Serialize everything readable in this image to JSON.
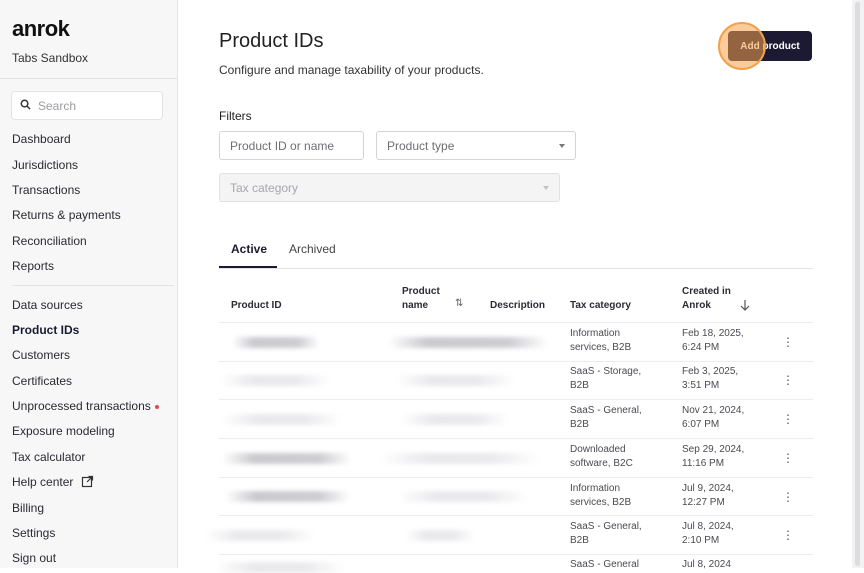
{
  "sidebar": {
    "logo": "anrok",
    "org_name": "Tabs Sandbox",
    "search_placeholder": "Search",
    "nav_group_1": [
      {
        "label": "Dashboard"
      },
      {
        "label": "Jurisdictions"
      },
      {
        "label": "Transactions"
      },
      {
        "label": "Returns & payments"
      },
      {
        "label": "Reconciliation"
      },
      {
        "label": "Reports"
      }
    ],
    "nav_group_2": [
      {
        "label": "Data sources"
      },
      {
        "label": "Product IDs"
      },
      {
        "label": "Customers"
      },
      {
        "label": "Certificates"
      },
      {
        "label": "Unprocessed transactions"
      },
      {
        "label": "Exposure modeling"
      },
      {
        "label": "Tax calculator"
      },
      {
        "label": "Help center"
      },
      {
        "label": "Billing"
      },
      {
        "label": "Settings"
      },
      {
        "label": "Sign out"
      }
    ],
    "active_item": "Product IDs"
  },
  "header": {
    "title": "Product IDs",
    "subtitle": "Configure and manage taxability of your products.",
    "add_button": "Add product"
  },
  "filters": {
    "label": "Filters",
    "product_id_placeholder": "Product ID or name",
    "product_type": "Product type",
    "tax_category": "Tax category"
  },
  "tabs": [
    {
      "label": "Active",
      "active": true
    },
    {
      "label": "Archived",
      "active": false
    }
  ],
  "table": {
    "headers": {
      "product_id": "Product ID",
      "product_name_1": "Product",
      "product_name_2": "name",
      "description": "Description",
      "tax_category": "Tax category",
      "created_1": "Created in",
      "created_2": "Anrok"
    },
    "rows": [
      {
        "tax_1": "Information",
        "tax_2": "services, B2B",
        "date_1": "Feb 18, 2025,",
        "date_2": "6:24 PM"
      },
      {
        "tax_1": "SaaS - Storage,",
        "tax_2": "B2B",
        "date_1": "Feb 3, 2025,",
        "date_2": "3:51 PM"
      },
      {
        "tax_1": "SaaS - General,",
        "tax_2": "B2B",
        "date_1": "Nov 21, 2024,",
        "date_2": "6:07 PM"
      },
      {
        "tax_1": "Downloaded",
        "tax_2": "software, B2C",
        "date_1": "Sep 29, 2024,",
        "date_2": "11:16 PM"
      },
      {
        "tax_1": "Information",
        "tax_2": "services, B2B",
        "date_1": "Jul 9, 2024,",
        "date_2": "12:27 PM"
      },
      {
        "tax_1": "SaaS - General,",
        "tax_2": "B2B",
        "date_1": "Jul 8, 2024,",
        "date_2": "2:10 PM"
      },
      {
        "tax_1": "SaaS - General",
        "tax_2": "",
        "date_1": "Jul 8, 2024",
        "date_2": ""
      }
    ]
  },
  "colors": {
    "accent": "#1c1a33",
    "highlight": "#f0a24a",
    "unread_dot": "#e5484d"
  }
}
